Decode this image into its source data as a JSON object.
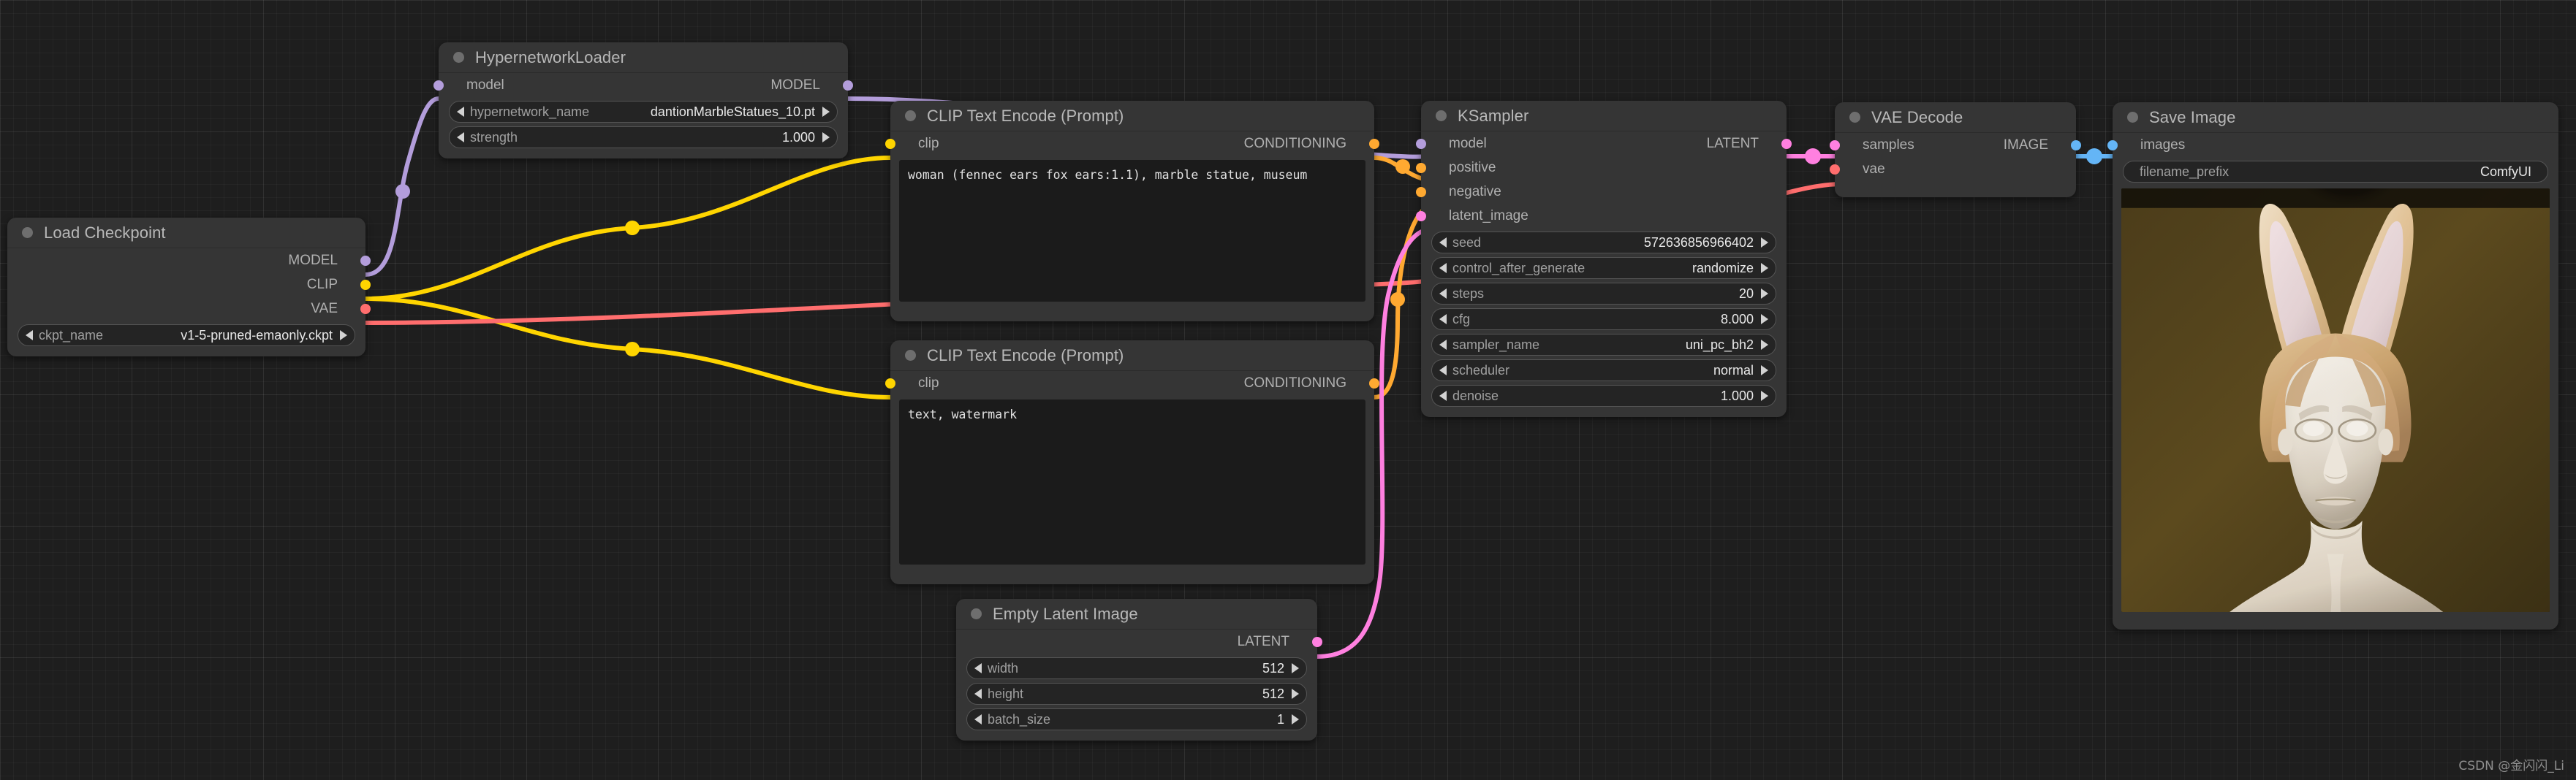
{
  "app": {
    "name": "ComfyUI",
    "watermark": "CSDN @金闪闪_Li",
    "canvas_bg": "#1e1e1e",
    "node_bg": "#353535",
    "node_title_bg": "#353535"
  },
  "port_colors": {
    "MODEL": "#b39ddb",
    "CLIP": "#ffd500",
    "VAE": "#ff6e6e",
    "CONDITIONING": "#ffa931",
    "LATENT": "#ff80e0",
    "IMAGE": "#64b5f6"
  },
  "nodes": [
    {
      "id": "load_checkpoint",
      "title": "Load Checkpoint",
      "inputs": [],
      "outputs": [
        {
          "label": "MODEL",
          "type": "MODEL"
        },
        {
          "label": "CLIP",
          "type": "CLIP"
        },
        {
          "label": "VAE",
          "type": "VAE"
        }
      ],
      "widgets": [
        {
          "name": "ckpt_name",
          "value": "v1-5-pruned-emaonly.ckpt",
          "arrows": true
        }
      ]
    },
    {
      "id": "hypernetwork_loader",
      "title": "HypernetworkLoader",
      "inputs": [
        {
          "label": "model",
          "type": "MODEL"
        }
      ],
      "outputs": [
        {
          "label": "MODEL",
          "type": "MODEL"
        }
      ],
      "widgets": [
        {
          "name": "hypernetwork_name",
          "value": "dantionMarbleStatues_10.pt",
          "arrows": true
        },
        {
          "name": "strength",
          "value": "1.000",
          "arrows": true
        }
      ]
    },
    {
      "id": "clip_text_encode_positive",
      "title": "CLIP Text Encode (Prompt)",
      "inputs": [
        {
          "label": "clip",
          "type": "CLIP"
        }
      ],
      "outputs": [
        {
          "label": "CONDITIONING",
          "type": "CONDITIONING"
        }
      ],
      "text": "woman (fennec ears fox ears:1.1), marble statue, museum"
    },
    {
      "id": "clip_text_encode_negative",
      "title": "CLIP Text Encode (Prompt)",
      "inputs": [
        {
          "label": "clip",
          "type": "CLIP"
        }
      ],
      "outputs": [
        {
          "label": "CONDITIONING",
          "type": "CONDITIONING"
        }
      ],
      "text": "text, watermark"
    },
    {
      "id": "ksampler",
      "title": "KSampler",
      "inputs": [
        {
          "label": "model",
          "type": "MODEL"
        },
        {
          "label": "positive",
          "type": "CONDITIONING"
        },
        {
          "label": "negative",
          "type": "CONDITIONING"
        },
        {
          "label": "latent_image",
          "type": "LATENT"
        }
      ],
      "outputs": [
        {
          "label": "LATENT",
          "type": "LATENT"
        }
      ],
      "widgets": [
        {
          "name": "seed",
          "value": "572636856966402",
          "arrows": true
        },
        {
          "name": "control_after_generate",
          "value": "randomize",
          "arrows": true
        },
        {
          "name": "steps",
          "value": "20",
          "arrows": true
        },
        {
          "name": "cfg",
          "value": "8.000",
          "arrows": true
        },
        {
          "name": "sampler_name",
          "value": "uni_pc_bh2",
          "arrows": true
        },
        {
          "name": "scheduler",
          "value": "normal",
          "arrows": true
        },
        {
          "name": "denoise",
          "value": "1.000",
          "arrows": true
        }
      ]
    },
    {
      "id": "vae_decode",
      "title": "VAE Decode",
      "inputs": [
        {
          "label": "samples",
          "type": "LATENT"
        },
        {
          "label": "vae",
          "type": "VAE"
        }
      ],
      "outputs": [
        {
          "label": "IMAGE",
          "type": "IMAGE"
        }
      ],
      "widgets": []
    },
    {
      "id": "save_image",
      "title": "Save Image",
      "inputs": [
        {
          "label": "images",
          "type": "IMAGE"
        }
      ],
      "outputs": [],
      "widgets": [
        {
          "name": "filename_prefix",
          "value": "ComfyUI",
          "arrows": false
        }
      ],
      "preview": {
        "description": "marble statue bust of a woman with fennec fox ears on dark olive background"
      }
    }
  ]
}
